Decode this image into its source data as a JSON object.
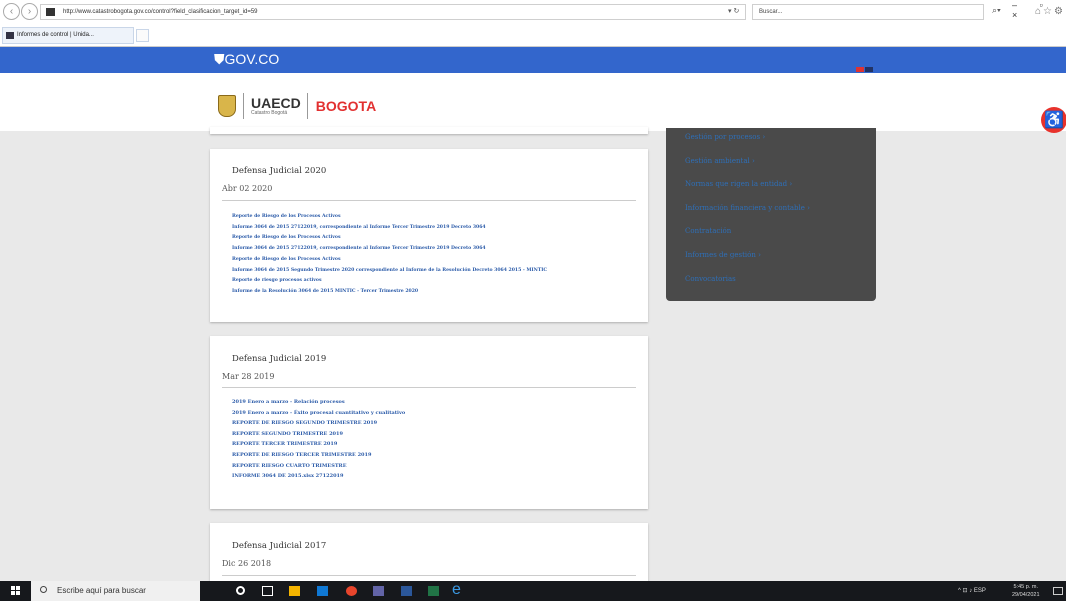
{
  "browser": {
    "url": "http://www.catastrobogota.gov.co/control?field_clasificacion_target_id=59",
    "url_domain": "catastrobogota.gov.co",
    "search_placeholder": "Buscar...",
    "tab_label": "Informes de control | Unida...",
    "window_controls": "– ▫ ×"
  },
  "govbar": {
    "logo_text": "GOV.CO"
  },
  "header": {
    "logo_main": "UAECD",
    "logo_sub": "Catastro Bogotá",
    "logo_city": "BOGOTA"
  },
  "cards": [
    {
      "title": "Defensa Judicial 2020",
      "date": "Abr 02 2020",
      "links": [
        "Reporte de Riesgo de los Procesos Activos",
        "Informe 3064 de 2015 27122019, correspondiente al Informe Tercer Trimestre 2019 Decreto 3064",
        "Reporte de Riesgo de los Procesos Activos",
        "Informe 3064 de 2015 27122019, correspondiente al Informe Tercer Trimestre 2019 Decreto 3064",
        "Reporte de Riesgo de los Procesos Activos",
        "Informe 3064 de 2015 Segundo Trimestre 2020 correspondiente al Informe de la Resolución Decreto 3064 2015 - MINTIC",
        "Reporte de riesgo procesos activos",
        "Informe de la Resolución 3064 de 2015 MINTIC - Tercer Trimestre 2020"
      ]
    },
    {
      "title": "Defensa Judicial 2019",
      "date": "Mar 28 2019",
      "links": [
        "2019 Enero a marzo - Relación procesos",
        "2019 Enero a marzo - Éxito procesal cuantitativo y cualitativo",
        "REPORTE DE RIESGO SEGUNDO TRIMESTRE 2019",
        "REPORTE SEGUNDO TRIMESTRE 2019",
        "REPORTE TERCER TRIMESTRE 2019",
        "REPORTE DE RIESGO TERCER TRIMESTRE 2019",
        "REPORTE RIESGO CUARTO TRIMESTRE",
        "INFORME 3064 DE 2015.xlsx 27122019"
      ]
    },
    {
      "title": "Defensa Judicial 2017",
      "date": "Dic 26 2018",
      "links": []
    }
  ],
  "side_menu": [
    "Gestión por procesos ›",
    "Gestión ambiental ›",
    "Normas que rigen la entidad ›",
    "Información financiera y contable ›",
    "Contratación",
    "Informes de gestión ›",
    "Convocatorias"
  ],
  "taskbar": {
    "search_placeholder": "Escribe aquí para buscar",
    "lang": "ESP",
    "time": "5:45 p. m.",
    "date": "29/04/2021"
  },
  "colors": {
    "gov_blue": "#3366cc",
    "link_blue": "#2a5aa8",
    "side_bg": "#4a4a4a"
  }
}
